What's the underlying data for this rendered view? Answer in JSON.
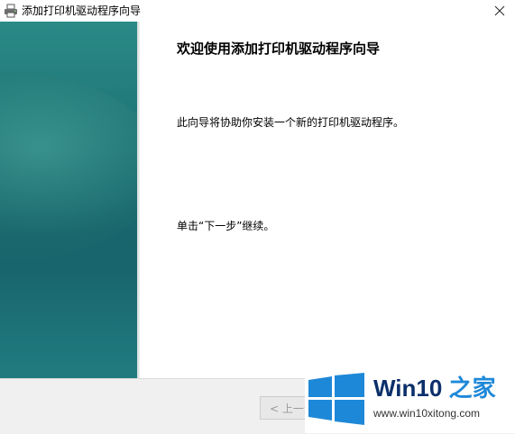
{
  "window": {
    "title": "添加打印机驱动程序向导",
    "icon": "printer-icon",
    "close_icon": "close-icon"
  },
  "main": {
    "heading": "欢迎使用添加打印机驱动程序向导",
    "description": "此向导将协助你安装一个新的打印机驱动程序。",
    "continue_hint": "单击“下一步”继续。"
  },
  "footer": {
    "back_label": "< 上一步"
  },
  "watermark": {
    "name": "Win10",
    "name_accent": "之家",
    "url": "www.win10xitong.com",
    "colors": {
      "flag": "#1e88d8",
      "text": "#0b2f6b"
    }
  }
}
